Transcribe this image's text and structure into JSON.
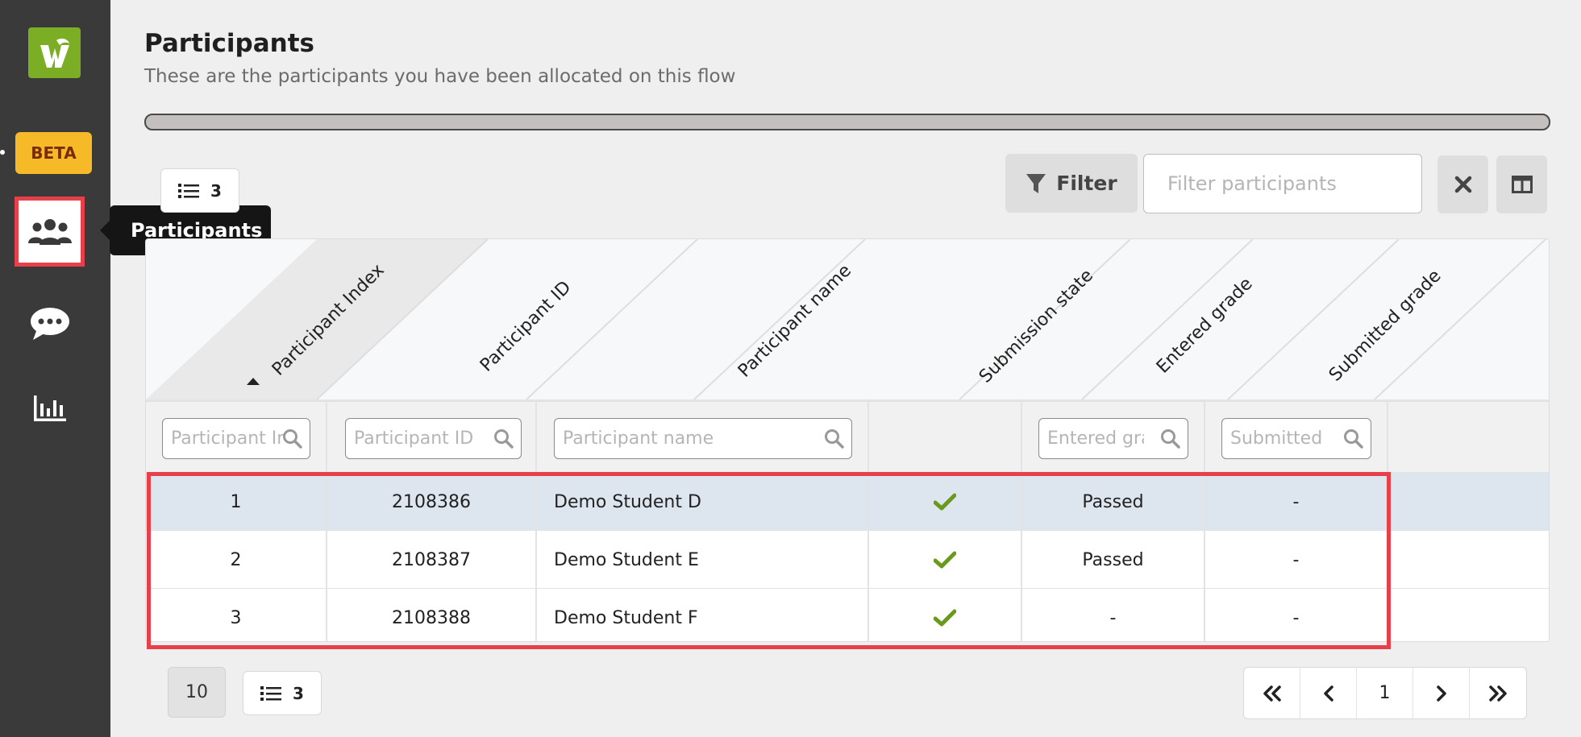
{
  "sidebar": {
    "beta_label": "BETA",
    "tooltip": "Participants",
    "items": [
      {
        "icon": "users-icon",
        "active": true
      },
      {
        "icon": "chat-icon",
        "active": false
      },
      {
        "icon": "bar-chart-icon",
        "active": false
      }
    ]
  },
  "header": {
    "title": "Participants",
    "subtitle": "These are the participants you have been allocated on this flow"
  },
  "toolbar": {
    "list_count": "3",
    "filter_label": "Filter",
    "filter_placeholder": "Filter participants"
  },
  "table": {
    "columns": [
      {
        "label": "Participant Index",
        "filter_placeholder": "Participant Index",
        "sorted": "asc"
      },
      {
        "label": "Participant ID",
        "filter_placeholder": "Participant ID"
      },
      {
        "label": "Participant name",
        "filter_placeholder": "Participant name"
      },
      {
        "label": "Submission state",
        "filter_placeholder": ""
      },
      {
        "label": "Entered grade",
        "filter_placeholder": "Entered grade"
      },
      {
        "label": "Submitted grade",
        "filter_placeholder": "Submitted grade"
      }
    ],
    "rows": [
      {
        "index": "1",
        "id": "2108386",
        "name": "Demo Student D",
        "submitted": true,
        "entered_grade": "Passed",
        "submitted_grade": "-",
        "selected": true
      },
      {
        "index": "2",
        "id": "2108387",
        "name": "Demo Student E",
        "submitted": true,
        "entered_grade": "Passed",
        "submitted_grade": "-",
        "selected": false
      },
      {
        "index": "3",
        "id": "2108388",
        "name": "Demo Student F",
        "submitted": true,
        "entered_grade": "-",
        "submitted_grade": "-",
        "selected": false
      }
    ]
  },
  "pagination": {
    "page_size": "10",
    "list_count": "3",
    "current_page": "1"
  },
  "colors": {
    "accent_green": "#7bae24",
    "beta_yellow": "#f6b928",
    "highlight_red": "#e8404a",
    "check_green": "#6a9a1c",
    "sidebar_bg": "#3a3a3a"
  }
}
